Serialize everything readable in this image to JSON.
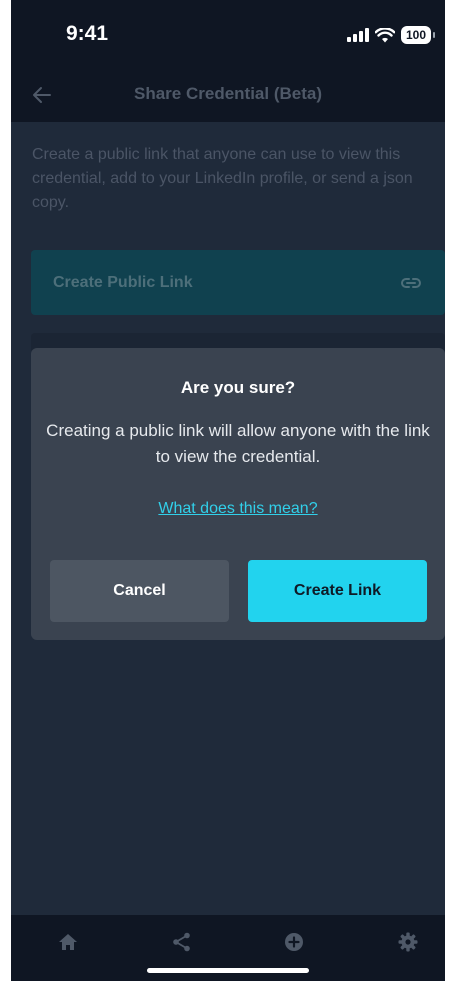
{
  "status_bar": {
    "time": "9:41",
    "battery": "100"
  },
  "header": {
    "title": "Share Credential (Beta)",
    "back_icon": "arrow-left-icon"
  },
  "content": {
    "description": "Create a public link that anyone can use to view this credential, add to your LinkedIn profile, or send a json copy.",
    "create_public_link_label": "Create Public Link",
    "create_public_link_icon": "link-icon"
  },
  "modal": {
    "title": "Are you sure?",
    "message": "Creating a public link will allow anyone with the link to view the credential.",
    "help_link": "What does this mean?",
    "cancel_label": "Cancel",
    "confirm_label": "Create Link"
  },
  "bottom_nav": {
    "items": [
      "home-icon",
      "share-icon",
      "add-circle-icon",
      "gear-icon"
    ]
  },
  "colors": {
    "background": "#1f2a3a",
    "bar": "#0f1623",
    "accent": "#22d3ee",
    "modal": "#3a4350"
  }
}
